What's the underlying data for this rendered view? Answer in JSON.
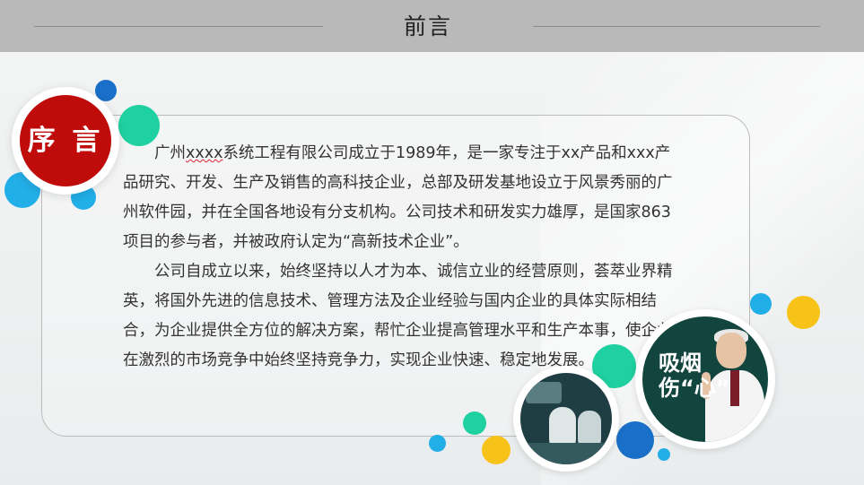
{
  "header": {
    "title": "前言"
  },
  "badge": {
    "label": "序 言"
  },
  "intro": {
    "p1_company": "广州",
    "p1_xxxx": "xxxx",
    "p1_rest": "系统工程有限公司成立于1989年，是一家专注于xx产品和xxx产品研究、开发、生产及销售的高科技企业，总部及研发基地设立于风景秀丽的广州软件园，并在全国各地设有分支机构。公司技术和研发实力雄厚，是国家863项目的参与者，并被政府认定为“高新技术企业”。",
    "p2": "公司自成立以来，始终坚持以人才为本、诚信立业的经营原则，荟萃业界精英，将国外先进的信息技术、管理方法及企业经验与国内企业的具体实际相结合，为企业提供全方位的解决方案，帮忙企业提高管理水平和生产本事，使企业在激烈的市场竞争中始终坚持竞争力，实现企业快速、稳定地发展。"
  },
  "poster": {
    "headline_1": "吸烟",
    "headline_2": "伤“心”"
  },
  "colors": {
    "header_bg": "#b9b9b9",
    "badge_red": "#c00b0b",
    "blue": "#1a73c9",
    "cyan": "#22aee6",
    "green": "#1fd0a0",
    "yellow": "#f7c319"
  }
}
